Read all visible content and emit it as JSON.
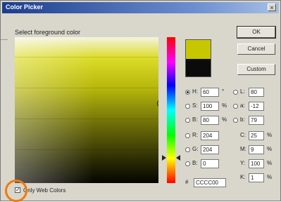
{
  "window": {
    "title": "Color Picker",
    "close_label": "×"
  },
  "prompt": "Select foreground color",
  "buttons": {
    "ok": "OK",
    "cancel": "Cancel",
    "custom": "Custom"
  },
  "hsb": [
    {
      "label": "H:",
      "value": "60",
      "unit": "°",
      "checked": true
    },
    {
      "label": "S:",
      "value": "100",
      "unit": "%",
      "checked": false
    },
    {
      "label": "B:",
      "value": "80",
      "unit": "%",
      "checked": false
    }
  ],
  "rgb": [
    {
      "label": "R:",
      "value": "204",
      "checked": false
    },
    {
      "label": "G:",
      "value": "204",
      "checked": false
    },
    {
      "label": "B:",
      "value": "0",
      "checked": false
    }
  ],
  "lab": [
    {
      "label": "L:",
      "value": "80"
    },
    {
      "label": "a:",
      "value": "-12"
    },
    {
      "label": "b:",
      "value": "79"
    }
  ],
  "cmyk": [
    {
      "label": "C:",
      "value": "25",
      "unit": "%"
    },
    {
      "label": "M:",
      "value": "9",
      "unit": "%"
    },
    {
      "label": "Y:",
      "value": "100",
      "unit": "%"
    },
    {
      "label": "K:",
      "value": "1",
      "unit": "%"
    }
  ],
  "hex": {
    "label": "#",
    "value": "CCCC00"
  },
  "web_only": {
    "label": "Only Web Colors",
    "checked": true
  },
  "colors": {
    "new": "#c7c700",
    "old": "#0b0b0b",
    "highlight": "#f07a0a"
  },
  "icons": {
    "checkbox": "checkbox-icon",
    "radio": "radio-icon"
  }
}
